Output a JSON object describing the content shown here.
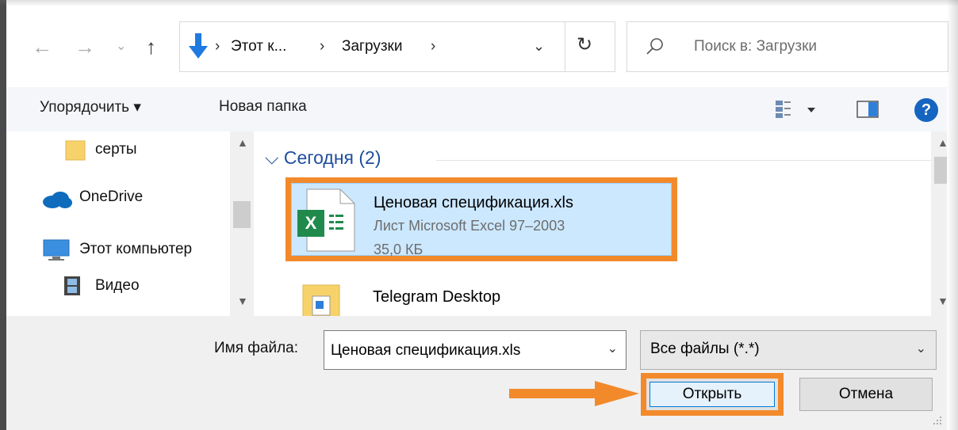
{
  "nav": {
    "back": "←",
    "forward": "→",
    "recent": "⌄",
    "up": "↑"
  },
  "address": {
    "crumbs": [
      "Этот к...",
      "Загрузки"
    ],
    "separator": "›"
  },
  "search": {
    "placeholder": "Поиск в: Загрузки"
  },
  "toolbar": {
    "organize_label": "Упорядочить ▾",
    "new_folder_label": "Новая папка",
    "help_label": "?"
  },
  "navpane": {
    "items": [
      {
        "label": "серты",
        "icon": "folder-icon"
      },
      {
        "label": "OneDrive",
        "icon": "cloud-icon"
      },
      {
        "label": "Этот компьютер",
        "icon": "computer-icon"
      },
      {
        "label": "Видео",
        "icon": "video-icon"
      }
    ]
  },
  "content": {
    "group_header": "Сегодня (2)",
    "files": [
      {
        "name": "Ценовая спецификация.xls",
        "type": "Лист Microsoft Excel 97–2003",
        "size": "35,0 КБ",
        "icon": "excel-file-icon"
      },
      {
        "name": "Telegram Desktop",
        "icon": "folder-icon"
      }
    ]
  },
  "bottom": {
    "filename_label": "Имя файла:",
    "filename_value": "Ценовая спецификация.xls",
    "filetype_value": "Все файлы (*.*)",
    "open_label": "Открыть",
    "cancel_label": "Отмена"
  },
  "colors": {
    "highlight": "#f28a2b",
    "selection": "#cce8ff",
    "accent": "#0078d7",
    "group_header": "#1e4e9c"
  }
}
